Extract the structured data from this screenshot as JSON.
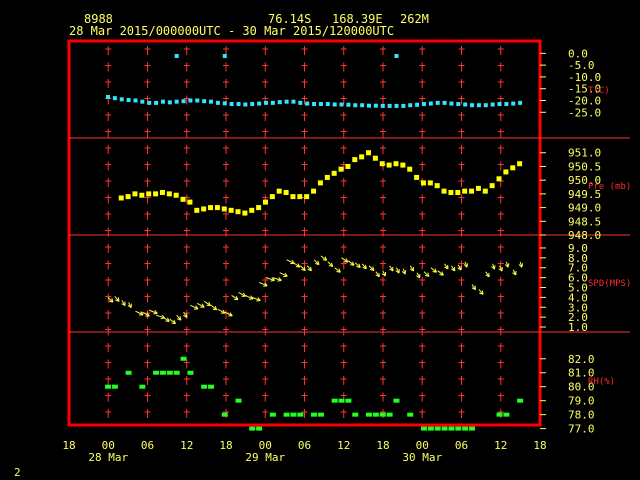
{
  "header": {
    "station_id": "8988",
    "lat": "76.14S",
    "lon": "168.39E",
    "elev": "262M",
    "time_range": "28 Mar 2015/000000UTC - 30 Mar 2015/120000UTC"
  },
  "corner_label": "2",
  "colors": {
    "frame": "#ff0000",
    "grid": "#ff3333",
    "text": "#ffff66",
    "temperature": "#33e6ff",
    "pressure": "#ffff00",
    "wind": "#ffff44",
    "rh": "#22ff22",
    "background": "#000000"
  },
  "chart_data": [
    {
      "type": "scatter",
      "name": "temperature",
      "ylabel": "T(C)",
      "yticks": [
        "0.0",
        "-5.0",
        "-10.0",
        "-15.0",
        "-20.0",
        "-25.0"
      ],
      "ylim": [
        -27,
        1
      ],
      "x": [
        0,
        1,
        2,
        3,
        4,
        5,
        6,
        7,
        8,
        9,
        10,
        11,
        12,
        13,
        14,
        15,
        16,
        17,
        18,
        19,
        20,
        21,
        22,
        23,
        24,
        25,
        26,
        27,
        28,
        29,
        30,
        31,
        32,
        33,
        34,
        35,
        36,
        37,
        38,
        39,
        40,
        41,
        42,
        43,
        44,
        45,
        46,
        47,
        48,
        49,
        50,
        51,
        52,
        53,
        54,
        55,
        56,
        57,
        58,
        59,
        60
      ],
      "y": [
        -18.5,
        -19,
        -19.5,
        -19.8,
        -20,
        -20.5,
        -21,
        -21,
        -20.5,
        -20.8,
        -20.5,
        -20.3,
        -20,
        -20,
        -20.3,
        -20.5,
        -21,
        -21.2,
        -21.5,
        -21.5,
        -21.7,
        -21.5,
        -21.3,
        -21,
        -21,
        -20.7,
        -20.5,
        -20.5,
        -21,
        -21.3,
        -21.5,
        -21.5,
        -21.5,
        -21.7,
        -21.7,
        -21.8,
        -22,
        -22,
        -22.2,
        -22.2,
        -22.3,
        -22.3,
        -22.3,
        -22.3,
        -22,
        -21.8,
        -21.5,
        -21.3,
        -21,
        -21,
        -21.3,
        -21.5,
        -21.7,
        -22,
        -22,
        -22,
        -21.7,
        -21.5,
        -21.5,
        -21.3,
        -21
      ],
      "outliers": [
        {
          "x": 10,
          "y": 0
        },
        {
          "x": 17,
          "y": 0
        },
        {
          "x": 42,
          "y": 0
        }
      ]
    },
    {
      "type": "scatter",
      "name": "pressure",
      "ylabel": "Pre (mb)",
      "yticks": [
        "951.0",
        "950.5",
        "950.0",
        "949.5",
        "949.0",
        "948.5",
        "948.0"
      ],
      "ylim": [
        948.0,
        951.1
      ],
      "x": [
        2,
        3,
        4,
        5,
        6,
        7,
        8,
        9,
        10,
        11,
        12,
        13,
        14,
        15,
        16,
        17,
        18,
        19,
        20,
        21,
        22,
        23,
        24,
        25,
        26,
        27,
        28,
        29,
        30,
        31,
        32,
        33,
        34,
        35,
        36,
        37,
        38,
        39,
        40,
        41,
        42,
        43,
        44,
        45,
        46,
        47,
        48,
        49,
        50,
        51,
        52,
        53,
        54,
        55,
        56,
        57,
        58,
        59,
        60
      ],
      "y": [
        949.35,
        949.4,
        949.5,
        949.45,
        949.5,
        949.5,
        949.55,
        949.5,
        949.45,
        949.3,
        949.2,
        948.9,
        948.95,
        949.0,
        949.0,
        948.95,
        948.9,
        948.85,
        948.8,
        948.9,
        949.0,
        949.2,
        949.4,
        949.6,
        949.55,
        949.4,
        949.4,
        949.4,
        949.6,
        949.9,
        950.1,
        950.25,
        950.4,
        950.5,
        950.75,
        950.85,
        951.0,
        950.8,
        950.6,
        950.55,
        950.6,
        950.55,
        950.4,
        950.1,
        949.9,
        949.9,
        949.8,
        949.6,
        949.55,
        949.55,
        949.6,
        949.6,
        949.7,
        949.6,
        949.8,
        950.05,
        950.3,
        950.45,
        950.6
      ]
    },
    {
      "type": "scatter",
      "name": "wind",
      "ylabel": "SPD(MPS)",
      "yticks": [
        "9.0",
        "8.0",
        "7.0",
        "6.0",
        "5.0",
        "4.0",
        "3.0",
        "2.0",
        "1.0"
      ],
      "ylim": [
        0.6,
        9.4
      ],
      "x": [
        0,
        1,
        2,
        3,
        4,
        5,
        6,
        7,
        8,
        9,
        10,
        11,
        12,
        13,
        14,
        15,
        16,
        17,
        18,
        19,
        20,
        21,
        22,
        23,
        24,
        25,
        26,
        27,
        28,
        29,
        30,
        31,
        32,
        33,
        34,
        35,
        36,
        37,
        38,
        39,
        40,
        41,
        42,
        43,
        44,
        45,
        46,
        47,
        48,
        49,
        50,
        51,
        52,
        53,
        54,
        55,
        56,
        57,
        58,
        59,
        60
      ],
      "speed": [
        4.0,
        4.1,
        3.7,
        3.5,
        2.6,
        2.5,
        2.7,
        2.2,
        2.0,
        1.8,
        2.2,
        2.5,
        3.2,
        3.4,
        3.6,
        3.2,
        2.8,
        2.5,
        4.2,
        4.5,
        4.2,
        4.0,
        5.5,
        6.0,
        6.0,
        6.5,
        7.8,
        7.5,
        7.2,
        7.2,
        7.8,
        8.2,
        7.6,
        7.0,
        8.0,
        7.7,
        7.5,
        7.4,
        7.2,
        6.6,
        6.7,
        7.2,
        7.0,
        6.9,
        7.2,
        6.5,
        6.6,
        7.0,
        6.7,
        7.4,
        7.2,
        7.3,
        7.6,
        5.3,
        4.8,
        6.6,
        7.4,
        7.2,
        7.6,
        6.8,
        7.6
      ],
      "direction": [
        60,
        65,
        70,
        75,
        40,
        45,
        35,
        30,
        50,
        55,
        65,
        70,
        40,
        45,
        50,
        55,
        45,
        40,
        50,
        45,
        40,
        35,
        35,
        30,
        30,
        40,
        40,
        50,
        60,
        65,
        60,
        55,
        60,
        55,
        50,
        55,
        60,
        65,
        60,
        70,
        75,
        70,
        75,
        80,
        70,
        75,
        60,
        55,
        55,
        70,
        70,
        75,
        80,
        70,
        65,
        70,
        80,
        75,
        80,
        75,
        80
      ]
    },
    {
      "type": "scatter",
      "name": "rh",
      "ylabel": "RH(%)",
      "yticks": [
        "82.0",
        "81.0",
        "80.0",
        "79.0",
        "78.0",
        "77.0"
      ],
      "ylim": [
        76.9,
        82.7
      ],
      "x": [
        0,
        1,
        2,
        3,
        4,
        5,
        6,
        7,
        8,
        9,
        10,
        11,
        12,
        13,
        14,
        15,
        16,
        17,
        18,
        19,
        20,
        21,
        22,
        23,
        24,
        25,
        26,
        27,
        28,
        29,
        30,
        31,
        32,
        33,
        34,
        35,
        36,
        37,
        38,
        39,
        40,
        41,
        42,
        43,
        44,
        45,
        46,
        47,
        48,
        49,
        50,
        51,
        52,
        53,
        54,
        55,
        56,
        57,
        58,
        59,
        60
      ],
      "y": [
        80,
        80,
        null,
        81,
        null,
        80,
        null,
        81,
        81,
        81,
        81,
        82,
        81,
        null,
        80,
        80,
        null,
        78,
        null,
        79,
        null,
        77,
        77,
        null,
        78,
        null,
        78,
        78,
        78,
        null,
        78,
        78,
        null,
        79,
        79,
        79,
        78,
        null,
        78,
        78,
        78,
        78,
        79,
        null,
        78,
        null,
        77,
        77,
        77,
        77,
        77,
        77,
        77,
        77,
        null,
        null,
        null,
        78,
        78,
        null,
        79
      ]
    }
  ],
  "x_axis": {
    "hour_labels": [
      "18",
      "00",
      "06",
      "12",
      "18",
      "00",
      "06",
      "12",
      "18",
      "00",
      "06",
      "12",
      "18"
    ],
    "date_labels": [
      {
        "label": "28 Mar",
        "hour_index": 1
      },
      {
        "label": "29 Mar",
        "hour_index": 5
      },
      {
        "label": "30 Mar",
        "hour_index": 9
      }
    ]
  }
}
